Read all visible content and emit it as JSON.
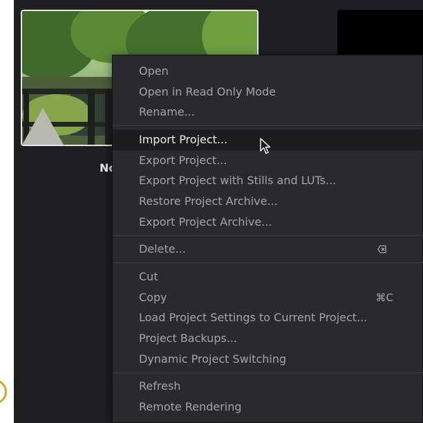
{
  "project": {
    "name": "No"
  },
  "menu": {
    "group1": [
      {
        "label": "Open"
      },
      {
        "label": "Open in Read Only Mode"
      },
      {
        "label": "Rename..."
      }
    ],
    "group2": [
      {
        "label": "Import Project..."
      },
      {
        "label": "Export Project..."
      },
      {
        "label": "Export Project with Stills and LUTs..."
      },
      {
        "label": "Restore Project Archive..."
      },
      {
        "label": "Export Project Archive..."
      }
    ],
    "group3": [
      {
        "label": "Delete..."
      }
    ],
    "group4": [
      {
        "label": "Cut"
      },
      {
        "label": "Copy",
        "shortcut": "⌘C"
      },
      {
        "label": "Load Project Settings to Current Project..."
      },
      {
        "label": "Project Backups..."
      },
      {
        "label": "Dynamic Project Switching"
      }
    ],
    "group5": [
      {
        "label": "Refresh"
      },
      {
        "label": "Remote Rendering"
      }
    ]
  },
  "icons": {
    "delete": "delete-icon",
    "cursor": "mouse-cursor-icon"
  },
  "colors": {
    "background": "#1f1f23",
    "menu_bg": "#2a2a2e",
    "highlight": "#1d1d20",
    "text": "#a5a5a9",
    "text_highlight": "#ececee",
    "accent_ring": "#d9a41b"
  }
}
